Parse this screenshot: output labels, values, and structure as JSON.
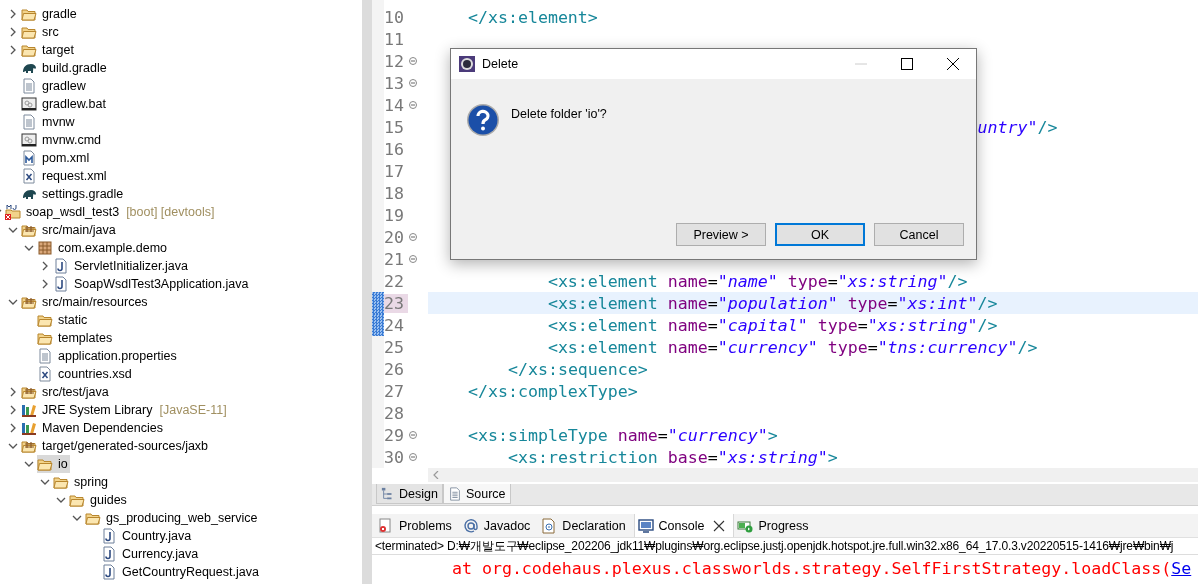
{
  "explorer": {
    "tree": [
      {
        "children": [
          {
            "label": "gradle",
            "kind": "folder",
            "expandable": true,
            "expanded": false,
            "selected": false
          },
          {
            "label": "src",
            "kind": "folder",
            "expandable": true,
            "expanded": false,
            "selected": false
          },
          {
            "label": "target",
            "kind": "folder",
            "expandable": true,
            "expanded": false,
            "selected": false
          },
          {
            "label": "build.gradle",
            "kind": "gradle",
            "expandable": false,
            "selected": false
          },
          {
            "label": "gradlew",
            "kind": "text",
            "expandable": false,
            "selected": false
          },
          {
            "label": "gradlew.bat",
            "kind": "script",
            "expandable": false,
            "selected": false
          },
          {
            "label": "mvnw",
            "kind": "text",
            "expandable": false,
            "selected": false
          },
          {
            "label": "mvnw.cmd",
            "kind": "script",
            "expandable": false,
            "selected": false
          },
          {
            "label": "pom.xml",
            "kind": "maven",
            "expandable": false,
            "selected": false
          },
          {
            "label": "request.xml",
            "kind": "xml",
            "expandable": false,
            "selected": false
          },
          {
            "label": "settings.gradle",
            "kind": "gradle",
            "expandable": false,
            "selected": false
          }
        ]
      },
      {
        "label": "soap_wsdl_test3",
        "decoration": "[boot] [devtools]",
        "kind": "project",
        "expandable": true,
        "expanded": true,
        "selected": false,
        "children": [
          {
            "label": "src/main/java",
            "kind": "srcfolder",
            "expandable": true,
            "expanded": true,
            "selected": false,
            "children": [
              {
                "label": "com.example.demo",
                "kind": "package",
                "expandable": true,
                "expanded": true,
                "selected": false,
                "children": [
                  {
                    "label": "ServletInitializer.java",
                    "kind": "java",
                    "expandable": true,
                    "expanded": false,
                    "selected": false
                  },
                  {
                    "label": "SoapWsdlTest3Application.java",
                    "kind": "java",
                    "expandable": true,
                    "expanded": false,
                    "selected": false
                  }
                ]
              }
            ]
          },
          {
            "label": "src/main/resources",
            "kind": "srcfolder",
            "expandable": true,
            "expanded": true,
            "selected": false,
            "children": [
              {
                "label": "static",
                "kind": "folder",
                "expandable": false,
                "selected": false
              },
              {
                "label": "templates",
                "kind": "folder",
                "expandable": false,
                "selected": false
              },
              {
                "label": "application.properties",
                "kind": "text",
                "expandable": false,
                "selected": false
              },
              {
                "label": "countries.xsd",
                "kind": "xml",
                "expandable": false,
                "selected": false
              }
            ]
          },
          {
            "label": "src/test/java",
            "kind": "srcfolder",
            "expandable": true,
            "expanded": false,
            "selected": false
          },
          {
            "label": "JRE System Library",
            "decoration": "[JavaSE-11]",
            "kind": "library",
            "expandable": true,
            "expanded": false,
            "selected": false
          },
          {
            "label": "Maven Dependencies",
            "kind": "library",
            "expandable": true,
            "expanded": false,
            "selected": false
          },
          {
            "label": "target/generated-sources/jaxb",
            "kind": "srcfolder",
            "expandable": true,
            "expanded": true,
            "selected": false,
            "children": [
              {
                "label": "io",
                "kind": "folder",
                "expandable": true,
                "expanded": true,
                "selected": true,
                "children": [
                  {
                    "label": "spring",
                    "kind": "folder",
                    "expandable": true,
                    "expanded": true,
                    "selected": false,
                    "children": [
                      {
                        "label": "guides",
                        "kind": "folder",
                        "expandable": true,
                        "expanded": true,
                        "selected": false,
                        "children": [
                          {
                            "label": "gs_producing_web_service",
                            "kind": "folder",
                            "expandable": true,
                            "expanded": true,
                            "selected": false,
                            "children": [
                              {
                                "label": "Country.java",
                                "kind": "java",
                                "expandable": false,
                                "selected": false
                              },
                              {
                                "label": "Currency.java",
                                "kind": "java",
                                "expandable": false,
                                "selected": false
                              },
                              {
                                "label": "GetCountryRequest.java",
                                "kind": "java",
                                "expandable": false,
                                "selected": false
                              }
                            ]
                          }
                        ]
                      }
                    ]
                  }
                ]
              }
            ]
          }
        ]
      }
    ]
  },
  "editor": {
    "lines": [
      {
        "number": "10",
        "fold": false,
        "changed": false,
        "highlight": false,
        "tokens": [
          {
            "kind": "tag",
            "text": "    </xs:element>"
          }
        ]
      },
      {
        "number": "11",
        "fold": false,
        "changed": false,
        "highlight": false
      },
      {
        "number": "12",
        "fold": true,
        "changed": false,
        "highlight": false
      },
      {
        "number": "13",
        "fold": true,
        "changed": false,
        "highlight": false
      },
      {
        "number": "14",
        "fold": true,
        "changed": false,
        "highlight": false
      },
      {
        "number": "15",
        "fold": false,
        "changed": false,
        "highlight": false,
        "tokens": [
          {
            "kind": "value",
            "text": "                                                       untry\""
          },
          {
            "kind": "tag",
            "text": "/>"
          }
        ]
      },
      {
        "number": "16",
        "fold": false,
        "changed": false,
        "highlight": false
      },
      {
        "number": "17",
        "fold": false,
        "changed": false,
        "highlight": false
      },
      {
        "number": "18",
        "fold": false,
        "changed": false,
        "highlight": false
      },
      {
        "number": "19",
        "fold": false,
        "changed": false,
        "highlight": false
      },
      {
        "number": "20",
        "fold": true,
        "changed": false,
        "highlight": false
      },
      {
        "number": "21",
        "fold": true,
        "changed": false,
        "highlight": false
      },
      {
        "number": "22",
        "fold": false,
        "changed": false,
        "highlight": false,
        "tokens": [
          {
            "kind": "tag",
            "text": "            <xs:element "
          },
          {
            "kind": "attr",
            "text": "name"
          },
          {
            "kind": "plain",
            "text": "="
          },
          {
            "kind": "value",
            "text": "\"name\" "
          },
          {
            "kind": "attr",
            "text": "type"
          },
          {
            "kind": "plain",
            "text": "="
          },
          {
            "kind": "value",
            "text": "\"xs:string\""
          },
          {
            "kind": "tag",
            "text": "/>"
          }
        ]
      },
      {
        "number": "23",
        "fold": false,
        "changed": true,
        "highlight": true,
        "tokens": [
          {
            "kind": "tag",
            "text": "            <xs:element "
          },
          {
            "kind": "attr",
            "text": "name"
          },
          {
            "kind": "plain",
            "text": "="
          },
          {
            "kind": "value",
            "text": "\"population\" "
          },
          {
            "kind": "attr",
            "text": "type"
          },
          {
            "kind": "plain",
            "text": "="
          },
          {
            "kind": "value",
            "text": "\"xs:int\""
          },
          {
            "kind": "tag",
            "text": "/>"
          }
        ]
      },
      {
        "number": "24",
        "fold": false,
        "changed": true,
        "highlight": false,
        "tokens": [
          {
            "kind": "tag",
            "text": "            <xs:element "
          },
          {
            "kind": "attr",
            "text": "name"
          },
          {
            "kind": "plain",
            "text": "="
          },
          {
            "kind": "value",
            "text": "\"capital\" "
          },
          {
            "kind": "attr",
            "text": "type"
          },
          {
            "kind": "plain",
            "text": "="
          },
          {
            "kind": "value",
            "text": "\"xs:string\""
          },
          {
            "kind": "tag",
            "text": "/>"
          }
        ]
      },
      {
        "number": "25",
        "fold": false,
        "changed": false,
        "highlight": false,
        "tokens": [
          {
            "kind": "tag",
            "text": "            <xs:element "
          },
          {
            "kind": "attr",
            "text": "name"
          },
          {
            "kind": "plain",
            "text": "="
          },
          {
            "kind": "value",
            "text": "\"currency\" "
          },
          {
            "kind": "attr",
            "text": "type"
          },
          {
            "kind": "plain",
            "text": "="
          },
          {
            "kind": "value",
            "text": "\"tns:currency\""
          },
          {
            "kind": "tag",
            "text": "/>"
          }
        ]
      },
      {
        "number": "26",
        "fold": false,
        "changed": false,
        "highlight": false,
        "tokens": [
          {
            "kind": "tag",
            "text": "        </xs:sequence>"
          }
        ]
      },
      {
        "number": "27",
        "fold": false,
        "changed": false,
        "highlight": false,
        "tokens": [
          {
            "kind": "tag",
            "text": "    </xs:complexType>"
          }
        ]
      },
      {
        "number": "28",
        "fold": false,
        "changed": false,
        "highlight": false
      },
      {
        "number": "29",
        "fold": true,
        "changed": false,
        "highlight": false,
        "tokens": [
          {
            "kind": "tag",
            "text": "    <xs:simpleType "
          },
          {
            "kind": "attr",
            "text": "name"
          },
          {
            "kind": "plain",
            "text": "="
          },
          {
            "kind": "value",
            "text": "\"currency\""
          },
          {
            "kind": "tag",
            "text": ">"
          }
        ]
      },
      {
        "number": "30",
        "fold": true,
        "changed": false,
        "highlight": false,
        "tokens": [
          {
            "kind": "tag",
            "text": "        <xs:restriction "
          },
          {
            "kind": "attr",
            "text": "base"
          },
          {
            "kind": "plain",
            "text": "="
          },
          {
            "kind": "value",
            "text": "\"xs:string\""
          },
          {
            "kind": "tag",
            "text": ">"
          }
        ]
      }
    ],
    "tabs": [
      {
        "label": "Design",
        "kind": "design",
        "selected": false
      },
      {
        "label": "Source",
        "kind": "source",
        "selected": true
      }
    ]
  },
  "views": {
    "tabs": [
      {
        "label": "Problems",
        "kind": "problems",
        "selected": false,
        "closable": false
      },
      {
        "label": "Javadoc",
        "kind": "javadoc",
        "selected": false,
        "closable": false
      },
      {
        "label": "Declaration",
        "kind": "declaration",
        "selected": false,
        "closable": false
      },
      {
        "label": "Console",
        "kind": "console",
        "selected": true,
        "closable": true
      },
      {
        "label": "Progress",
        "kind": "progress",
        "selected": false,
        "closable": false
      }
    ],
    "console_header": "<terminated> D:₩개발도구₩eclipse_202206_jdk11₩plugins₩org.eclipse.justj.openjdk.hotspot.jre.full.win32.x86_64_17.0.3.v20220515-1416₩jre₩bin₩j",
    "console_lines": [
      {
        "tokens": [
          {
            "kind": "error",
            "text": "        at org.codehaus.plexus.classworlds.strategy.SelfFirstStrategy.loadClass("
          },
          {
            "kind": "link",
            "text": "Se"
          }
        ]
      }
    ]
  },
  "dialog": {
    "title": "Delete",
    "message": "Delete folder 'io'?",
    "minimize_disabled": true,
    "buttons": [
      {
        "label": "Preview >",
        "default": false
      },
      {
        "label": "OK",
        "default": true
      },
      {
        "label": "Cancel",
        "default": false
      }
    ]
  }
}
